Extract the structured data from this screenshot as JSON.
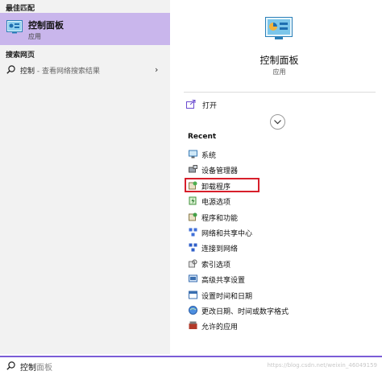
{
  "left": {
    "best_match_title": "最佳匹配",
    "best_match": {
      "title": "控制面板",
      "subtitle": "应用",
      "icon": "control-panel-icon"
    },
    "web_title": "搜索网页",
    "web_item": {
      "query": "控制",
      "suffix": " - 查看网络搜索结果",
      "icon": "search-icon"
    }
  },
  "right": {
    "title": "控制面板",
    "subtitle": "应用",
    "open_label": "打开",
    "recent_title": "Recent",
    "recent_items": [
      {
        "label": "系统",
        "icon": "system-icon"
      },
      {
        "label": "设备管理器",
        "icon": "device-manager-icon"
      },
      {
        "label": "卸载程序",
        "icon": "uninstall-program-icon"
      },
      {
        "label": "电源选项",
        "icon": "power-options-icon"
      },
      {
        "label": "程序和功能",
        "icon": "programs-features-icon"
      },
      {
        "label": "网络和共享中心",
        "icon": "network-sharing-icon"
      },
      {
        "label": "连接到网络",
        "icon": "connect-network-icon"
      },
      {
        "label": "索引选项",
        "icon": "indexing-options-icon"
      },
      {
        "label": "高级共享设置",
        "icon": "advanced-sharing-icon"
      },
      {
        "label": "设置时间和日期",
        "icon": "date-time-icon"
      },
      {
        "label": "更改日期、时间或数字格式",
        "icon": "region-format-icon"
      },
      {
        "label": "允许的应用",
        "icon": "allowed-apps-icon"
      }
    ]
  },
  "search": {
    "typed": "控制",
    "completion": "面板"
  },
  "watermark": "https://blog.csdn.net/weixin_46049159",
  "colors": {
    "selection": "#c9b6ec",
    "accent": "#7b5cd6",
    "highlight_box": "#d71f2b"
  }
}
